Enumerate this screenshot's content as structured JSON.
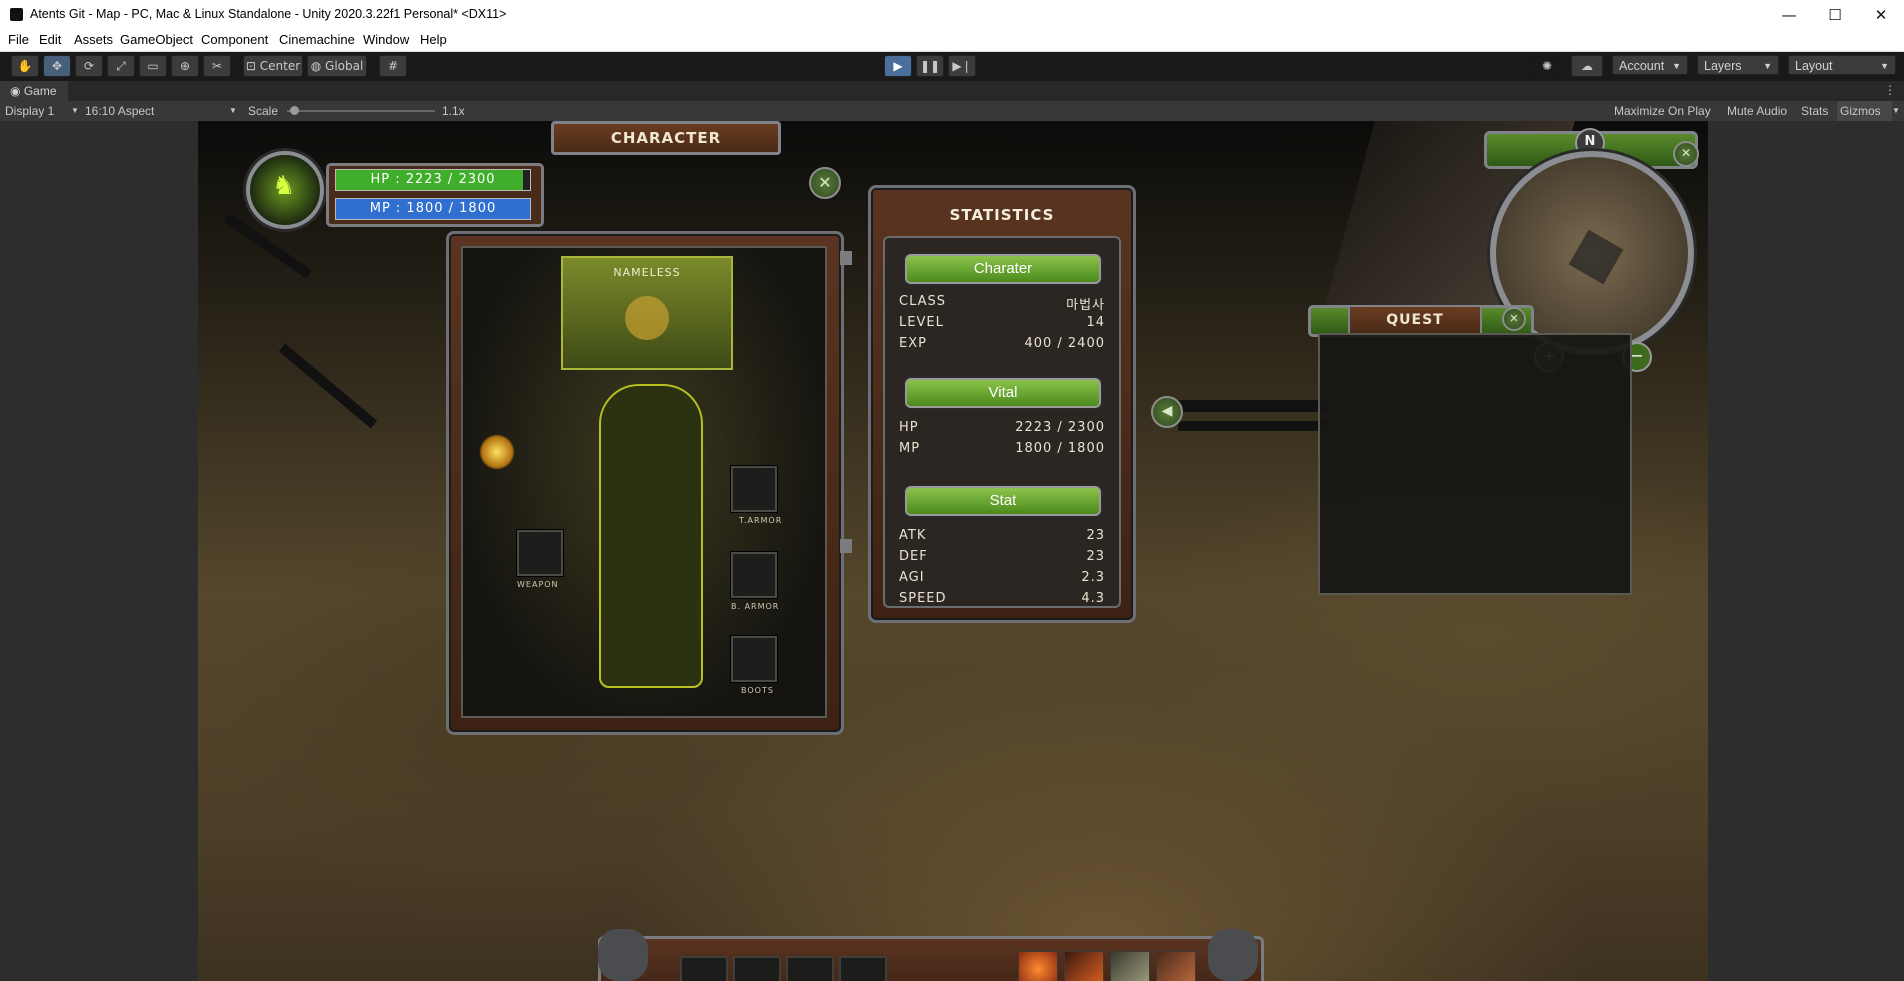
{
  "window": {
    "title": "Atents Git - Map - PC, Mac & Linux Standalone - Unity 2020.3.22f1 Personal* <DX11>",
    "minimize": "—",
    "maximize": "☐",
    "close": "✕"
  },
  "menu": [
    "File",
    "Edit",
    "Assets",
    "GameObject",
    "Component",
    "Cinemachine",
    "Window",
    "Help"
  ],
  "toolbar": {
    "tools": [
      "hand-tool",
      "move-tool",
      "rotate-tool",
      "scale-tool",
      "rect-tool",
      "transform-tool",
      "custom-tool"
    ],
    "pivot": "Center",
    "space": "Global",
    "account": "Account",
    "layers": "Layers",
    "layout": "Layout"
  },
  "game_tab": {
    "label": "Game",
    "display": "Display 1",
    "aspect": "16:10 Aspect",
    "scale_label": "Scale",
    "scale_value": "1.1x",
    "scale_fraction": 0.05,
    "maximize": "Maximize On Play",
    "mute": "Mute Audio",
    "stats": "Stats",
    "gizmos": "Gizmos"
  },
  "hud": {
    "hp": "HP : 2223 / 2300",
    "mp": "MP : 1800 / 1800",
    "hp_fraction": 0.966,
    "mp_fraction": 1.0
  },
  "character": {
    "title": "CHARACTER",
    "name": "NAMELESS",
    "slots": [
      "WEAPON",
      "T.ARMOR",
      "B. ARMOR",
      "BOOTS"
    ]
  },
  "statistics": {
    "title": "STATISTICS",
    "sections": {
      "charater": "Charater",
      "vital": "Vital",
      "stat": "Stat"
    },
    "charater_rows": [
      {
        "k": "CLASS",
        "v": "마법사"
      },
      {
        "k": "LEVEL",
        "v": "14"
      },
      {
        "k": "EXP",
        "v": "400 / 2400"
      }
    ],
    "vital_rows": [
      {
        "k": "HP",
        "v": "2223 / 2300"
      },
      {
        "k": "MP",
        "v": "1800 / 1800"
      }
    ],
    "stat_rows": [
      {
        "k": "ATK",
        "v": "23"
      },
      {
        "k": "DEF",
        "v": "23"
      },
      {
        "k": "AGI",
        "v": "2.3"
      },
      {
        "k": "SPEED",
        "v": "4.3"
      }
    ]
  },
  "quest": {
    "title": "QUEST"
  },
  "minimap": {
    "north": "N",
    "zoom_in": "+",
    "zoom_out": "−"
  },
  "colors": {
    "hp": "#3fae2a",
    "mp": "#2f6fd0",
    "accent": "#8bc34a"
  }
}
